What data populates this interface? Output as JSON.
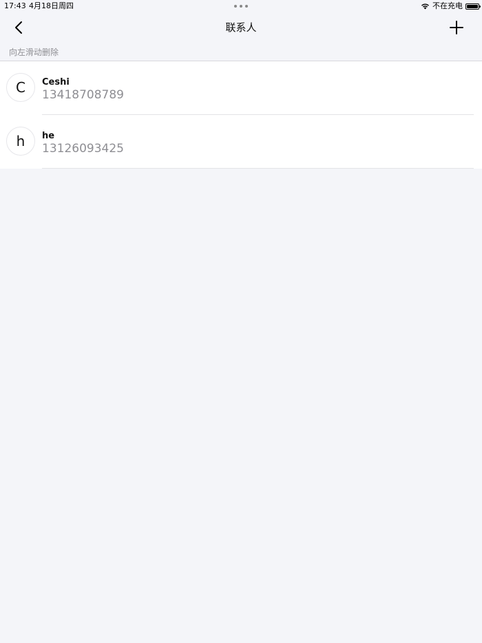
{
  "status_bar": {
    "time": "17:43",
    "date": "4月18日周四",
    "charging": "不在充电",
    "icons": [
      "wifi-icon",
      "battery-icon"
    ]
  },
  "nav": {
    "title": "联系人",
    "back_icon": "chevron-left-icon",
    "add_icon": "plus-icon"
  },
  "hint": "向左滑动删除",
  "contacts": [
    {
      "initial": "C",
      "name": "Ceshi",
      "phone": "13418708789"
    },
    {
      "initial": "h",
      "name": "he",
      "phone": "13126093425"
    }
  ],
  "colors": {
    "background": "#f4f5f9",
    "secondary_text": "#8e8e93",
    "list_background": "#ffffff"
  }
}
